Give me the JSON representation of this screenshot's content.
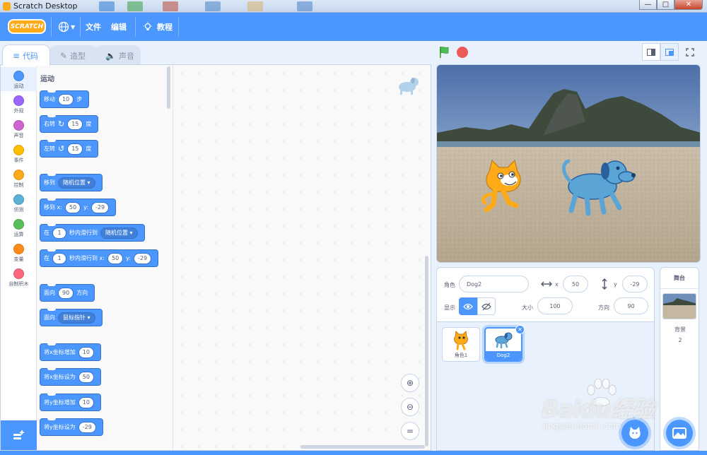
{
  "window": {
    "title": "Scratch Desktop",
    "minimize": "—",
    "maximize": "□",
    "close": "✕"
  },
  "menubar": {
    "logo": "SCRATCH",
    "language_icon": "globe-icon",
    "file": "文件",
    "edit": "编辑",
    "tutorials": "教程"
  },
  "tabs": [
    {
      "label": "代码",
      "active": true
    },
    {
      "label": "造型",
      "active": false
    },
    {
      "label": "声音",
      "active": false
    }
  ],
  "categories": [
    {
      "label": "运动",
      "color": "#4c97ff"
    },
    {
      "label": "外观",
      "color": "#9966ff"
    },
    {
      "label": "声音",
      "color": "#cf63cf"
    },
    {
      "label": "事件",
      "color": "#ffbf00"
    },
    {
      "label": "控制",
      "color": "#ffab19"
    },
    {
      "label": "侦测",
      "color": "#5cb1d6"
    },
    {
      "label": "运算",
      "color": "#59c059"
    },
    {
      "label": "变量",
      "color": "#ff8c1a"
    },
    {
      "label": "自制积木",
      "color": "#ff6680"
    }
  ],
  "palette": {
    "title": "运动",
    "blocks": {
      "move": {
        "label": "移动",
        "value": "10",
        "suffix": "步"
      },
      "turn_right": {
        "label": "右转",
        "value": "15",
        "suffix": "度"
      },
      "turn_left": {
        "label": "左转",
        "value": "15",
        "suffix": "度"
      },
      "goto": {
        "label": "移到",
        "dropdown": "随机位置"
      },
      "goto_xy": {
        "label": "移到 x:",
        "x": "50",
        "ylabel": "y:",
        "y": "-29"
      },
      "glide": {
        "label_pre": "在",
        "secs": "1",
        "label_mid": "秒内滑行到",
        "dropdown": "随机位置"
      },
      "glide_xy": {
        "label_pre": "在",
        "secs": "1",
        "label_mid": "秒内滑行到 x:",
        "x": "50",
        "ylabel": "y:",
        "y": "-29"
      },
      "point_dir": {
        "label": "面向",
        "value": "90",
        "suffix": "方向"
      },
      "point_towards": {
        "label": "面向",
        "dropdown": "鼠标指针"
      },
      "change_x": {
        "label": "将x坐标增加",
        "value": "10"
      },
      "set_x": {
        "label": "将x坐标设为",
        "value": "50"
      },
      "change_y": {
        "label": "将y坐标增加",
        "value": "10"
      },
      "set_y": {
        "label": "将y坐标设为",
        "value": "-29"
      }
    }
  },
  "workspace": {
    "zoom_in": "+",
    "zoom_out": "−",
    "zoom_reset": "="
  },
  "sprite_info": {
    "sprite_label": "角色",
    "sprite_name": "Dog2",
    "x_label": "x",
    "x": "50",
    "y_label": "y",
    "y": "-29",
    "show_label": "显示",
    "size_label": "大小",
    "size": "100",
    "direction_label": "方向",
    "direction": "90"
  },
  "sprites": [
    {
      "name": "角色1",
      "selected": false
    },
    {
      "name": "Dog2",
      "selected": true
    }
  ],
  "stage_panel": {
    "header": "舞台",
    "backdrops_label": "背景",
    "backdrops_count": "2"
  },
  "watermark": {
    "logo": "Baidu经验",
    "url": "jingyan.baidu.com"
  },
  "colors": {
    "accent": "#4c97ff",
    "motion": "#4c97ff",
    "stop": "#ec5959",
    "flag": "#4cbf56"
  }
}
